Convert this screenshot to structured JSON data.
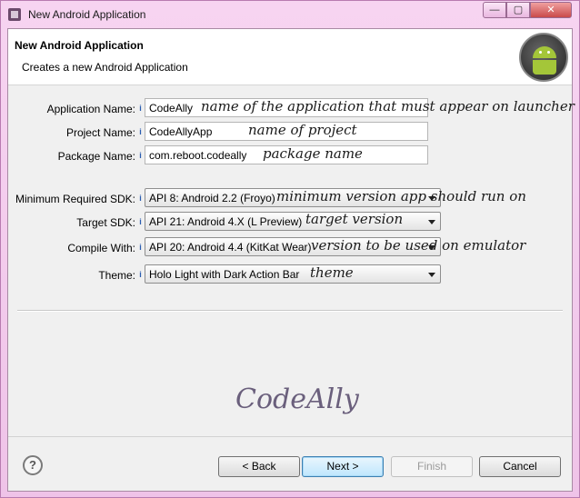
{
  "window": {
    "title": "New Android Application",
    "controls": {
      "minimize": "—",
      "maximize": "▢",
      "close": "✕"
    }
  },
  "header": {
    "title": "New Android Application",
    "subtitle": "Creates a new Android Application",
    "logo_icon": "android-robot-icon"
  },
  "form": {
    "help_glyph": "i",
    "application_name": {
      "label": "Application Name:",
      "value": "CodeAlly",
      "annotation": "name of the application that must appear on launcher"
    },
    "project_name": {
      "label": "Project Name:",
      "value": "CodeAllyApp",
      "annotation": "name of project"
    },
    "package_name": {
      "label": "Package Name:",
      "value": "com.reboot.codeally",
      "annotation": "package name"
    },
    "min_sdk": {
      "label": "Minimum Required SDK:",
      "value": "API 8: Android 2.2 (Froyo)",
      "annotation": "minimum version app should run on"
    },
    "target_sdk": {
      "label": "Target SDK:",
      "value": "API 21: Android 4.X (L Preview)",
      "annotation": "target version"
    },
    "compile_with": {
      "label": "Compile With:",
      "value": "API 20: Android 4.4 (KitKat Wear)",
      "annotation": "version to be used on emulator"
    },
    "theme": {
      "label": "Theme:",
      "value": "Holo Light with Dark Action Bar",
      "annotation": "theme"
    }
  },
  "watermark": "CodeAlly",
  "footer": {
    "help_label": "?",
    "back_label": "< Back",
    "next_label": "Next >",
    "finish_label": "Finish",
    "cancel_label": "Cancel"
  },
  "colors": {
    "window_frame": "#f4c8ee",
    "android_green": "#a4c639",
    "primary_button": "#bee6fd"
  }
}
